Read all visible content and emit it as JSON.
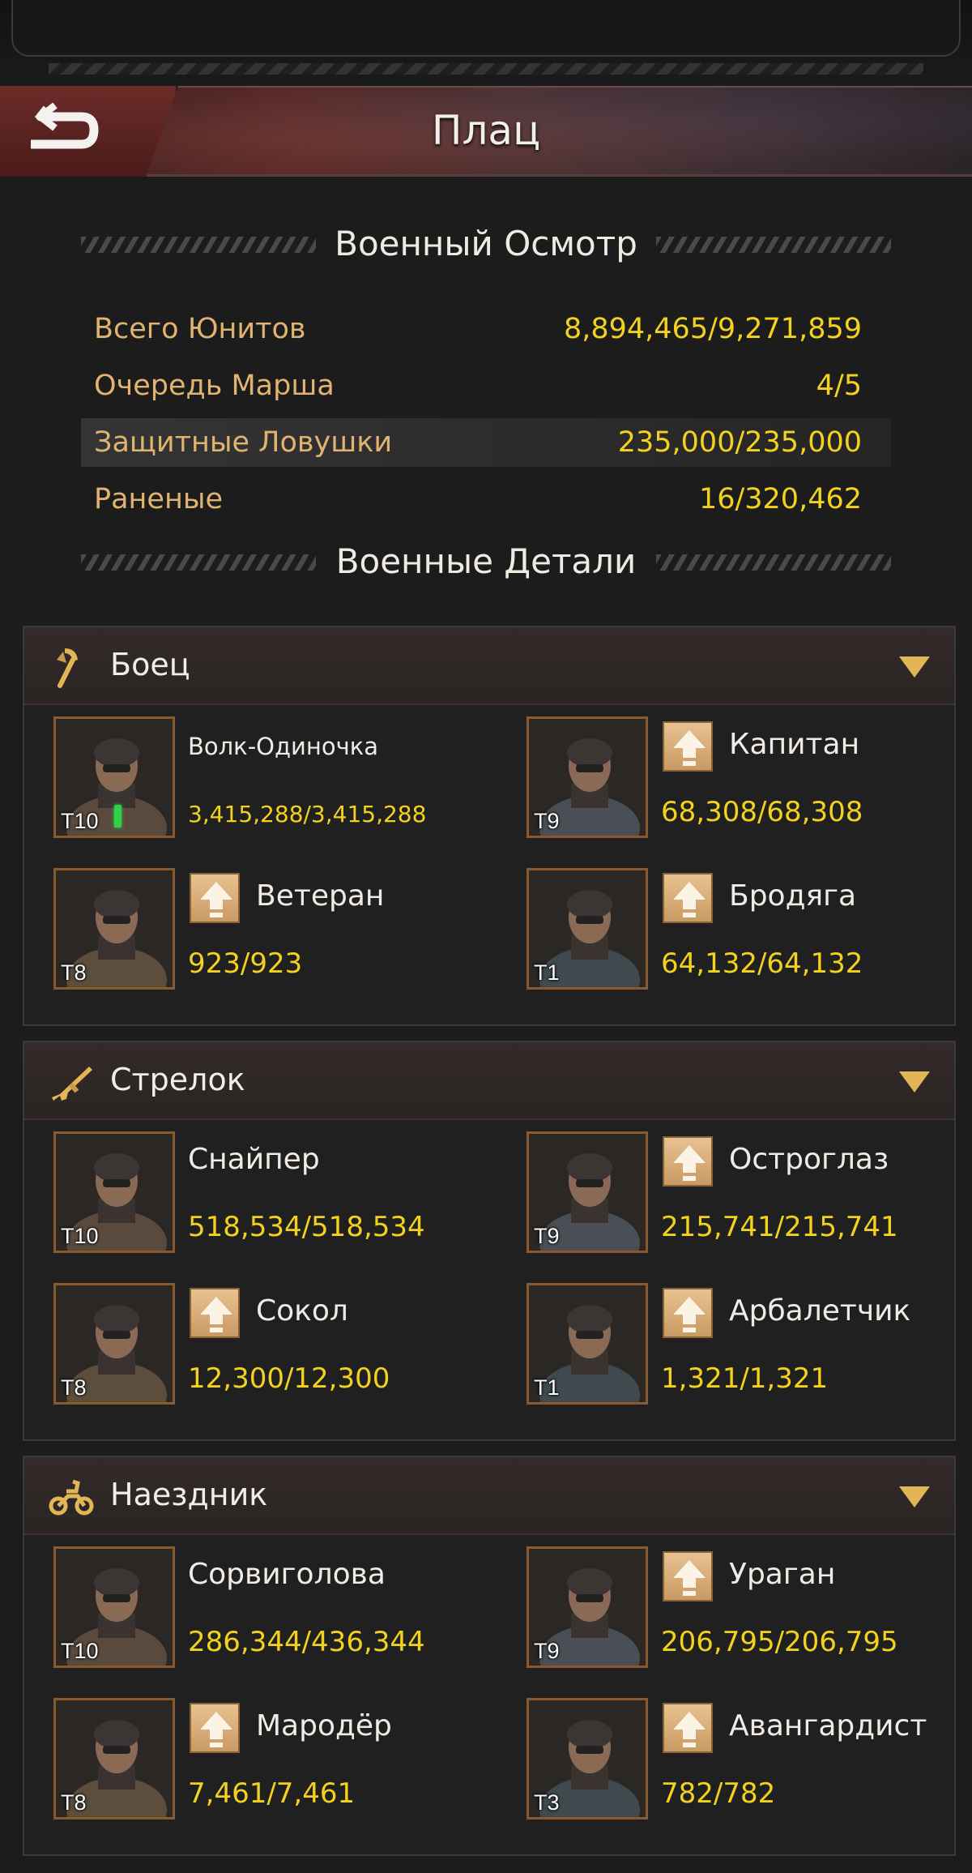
{
  "header": {
    "title": "Плац"
  },
  "review": {
    "title": "Военный Осмотр",
    "stats": [
      {
        "label": "Всего Юнитов",
        "value": "8,894,465/9,271,859"
      },
      {
        "label": "Очередь Марша",
        "value": "4/5"
      },
      {
        "label": "Защитные Ловушки",
        "value": "235,000/235,000"
      },
      {
        "label": "Раненые",
        "value": "16/320,462"
      }
    ]
  },
  "details": {
    "title": "Военные Детали"
  },
  "groups": [
    {
      "name": "Боец",
      "icon": "axe-icon",
      "units": [
        {
          "name": "Волк-Одиночка",
          "tier": "T10",
          "count": "3,415,288/3,415,288",
          "upgrade": false
        },
        {
          "name": "Капитан",
          "tier": "T9",
          "count": "68,308/68,308",
          "upgrade": true
        },
        {
          "name": "Ветеран",
          "tier": "T8",
          "count": "923/923",
          "upgrade": true
        },
        {
          "name": "Бродяга",
          "tier": "T1",
          "count": "64,132/64,132",
          "upgrade": true
        }
      ]
    },
    {
      "name": "Стрелок",
      "icon": "rifle-icon",
      "units": [
        {
          "name": "Снайпер",
          "tier": "T10",
          "count": "518,534/518,534",
          "upgrade": false
        },
        {
          "name": "Остроглаз",
          "tier": "T9",
          "count": "215,741/215,741",
          "upgrade": true
        },
        {
          "name": "Сокол",
          "tier": "T8",
          "count": "12,300/12,300",
          "upgrade": true
        },
        {
          "name": "Арбалетчик",
          "tier": "T1",
          "count": "1,321/1,321",
          "upgrade": true
        }
      ]
    },
    {
      "name": "Наездник",
      "icon": "motorcycle-icon",
      "units": [
        {
          "name": "Сорвиголова",
          "tier": "T10",
          "count": "286,344/436,344",
          "upgrade": false
        },
        {
          "name": "Ураган",
          "tier": "T9",
          "count": "206,795/206,795",
          "upgrade": true
        },
        {
          "name": "Мародёр",
          "tier": "T8",
          "count": "7,461/7,461",
          "upgrade": true
        },
        {
          "name": "Авангардист",
          "tier": "T3",
          "count": "782/782",
          "upgrade": true
        }
      ]
    }
  ],
  "colors": {
    "accent": "#f3d21e",
    "label": "#e0b470",
    "chevron": "#e2b656"
  }
}
